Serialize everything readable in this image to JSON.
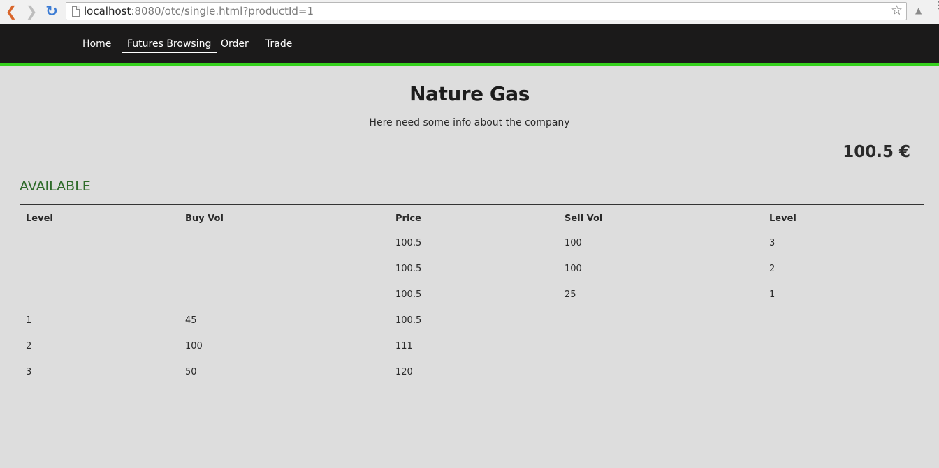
{
  "browser": {
    "url_host": "localhost",
    "url_rest": ":8080/otc/single.html?productId=1",
    "icons": [
      "back-arrow-icon",
      "forward-arrow-icon",
      "reload-icon",
      "page-icon",
      "star-icon",
      "extension-icon",
      "menu-icon"
    ]
  },
  "navbar": {
    "accent_color": "#35d11d",
    "items": [
      {
        "label": "Home",
        "active": false
      },
      {
        "label": "Futures Browsing",
        "active": true
      },
      {
        "label": "Order",
        "active": false
      },
      {
        "label": "Trade",
        "active": false
      }
    ]
  },
  "product": {
    "title": "Nature Gas",
    "description": "Here need some info about the company",
    "price": "100.5 €"
  },
  "orderbook": {
    "heading": "AVAILABLE",
    "heading_color": "#2e6b2a",
    "columns": [
      "Level",
      "Buy Vol",
      "Price",
      "Sell Vol",
      "Level"
    ],
    "rows": [
      [
        "",
        "",
        "100.5",
        "100",
        "3"
      ],
      [
        "",
        "",
        "100.5",
        "100",
        "2"
      ],
      [
        "",
        "",
        "100.5",
        "25",
        "1"
      ],
      [
        "1",
        "45",
        "100.5",
        "",
        ""
      ],
      [
        "2",
        "100",
        "111",
        "",
        ""
      ],
      [
        "3",
        "50",
        "120",
        "",
        ""
      ]
    ]
  }
}
